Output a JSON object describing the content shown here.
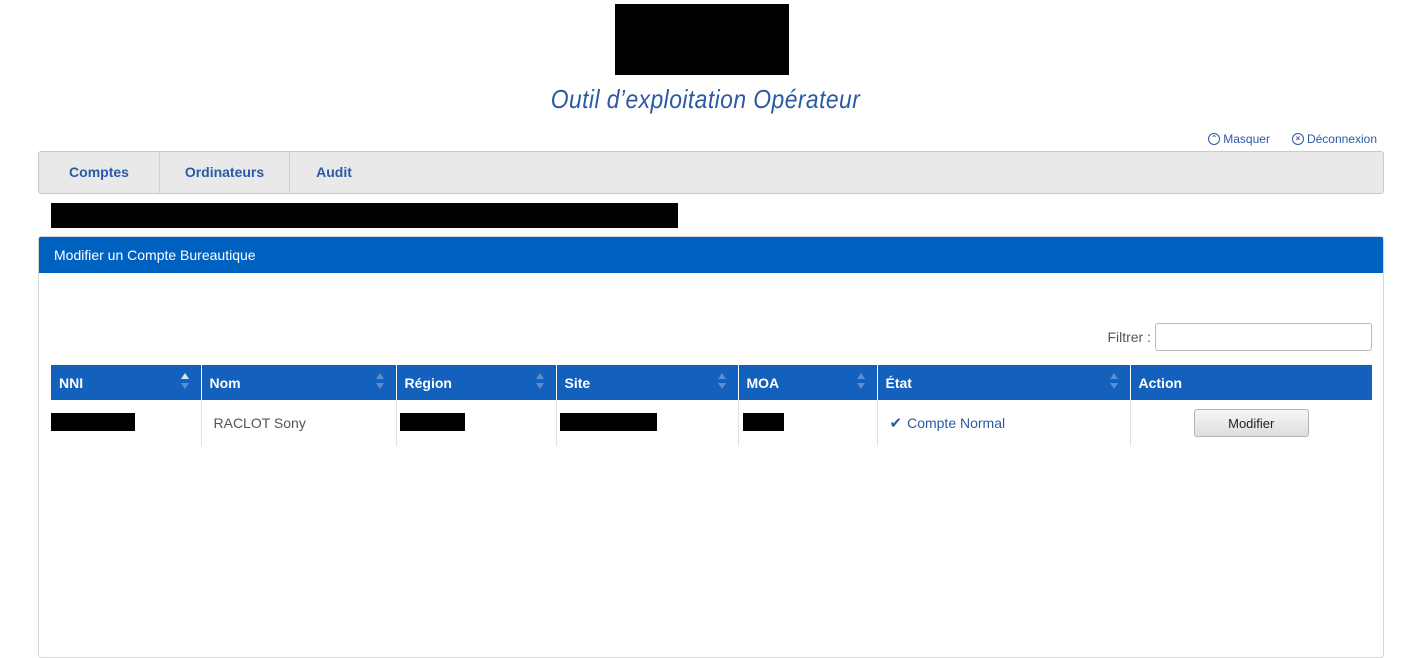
{
  "header": {
    "app_title": "Outil d’exploitation Opérateur",
    "links": {
      "masquer": "Masquer",
      "deconnexion": "Déconnexion"
    }
  },
  "nav": {
    "tabs": [
      "Comptes",
      "Ordinateurs",
      "Audit"
    ]
  },
  "panel": {
    "title": "Modifier un Compte Bureautique",
    "filter_label": "Filtrer :",
    "filter_value": ""
  },
  "table": {
    "columns": [
      "NNI",
      "Nom",
      "Région",
      "Site",
      "MOA",
      "État",
      "Action"
    ],
    "sort_column": "NNI",
    "rows": [
      {
        "nni": "",
        "nom": "RACLOT Sony",
        "region": "",
        "site": "",
        "moa": "",
        "etat": "Compte Normal",
        "action": "Modifier"
      }
    ]
  },
  "colors": {
    "accent": "#2a5aa5",
    "header_blue": "#0062c0",
    "table_header": "#1360bd"
  },
  "icons": {
    "masquer": "circle-chevron-up-icon",
    "deconnexion": "circle-x-icon",
    "etat": "checkmark-icon"
  }
}
